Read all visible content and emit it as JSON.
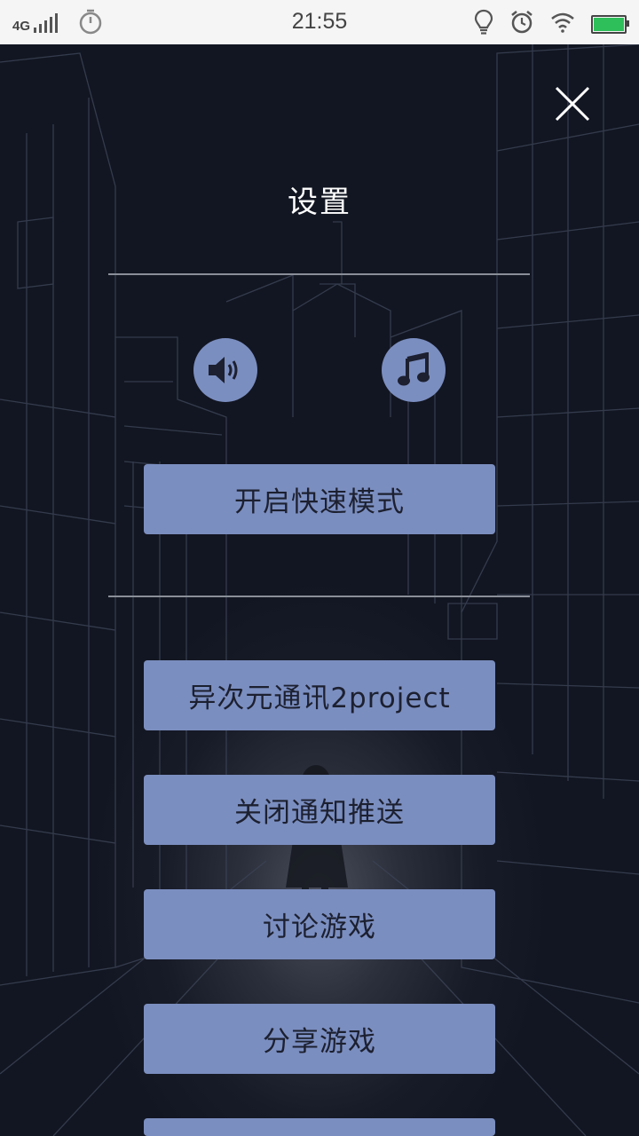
{
  "status_bar": {
    "network": "4G",
    "time": "21:55",
    "icons": [
      "signal-icon",
      "timer-icon",
      "bulb-icon",
      "alarm-icon",
      "wifi-icon",
      "battery-charging-icon"
    ]
  },
  "settings": {
    "title": "设置",
    "close_icon": "close-icon",
    "sound_icon": "speaker-icon",
    "music_icon": "music-note-icon",
    "fast_mode_label": "开启快速模式",
    "menu": [
      {
        "label": "异次元通讯2project"
      },
      {
        "label": "关闭通知推送"
      },
      {
        "label": "讨论游戏"
      },
      {
        "label": "分享游戏"
      }
    ]
  },
  "colors": {
    "button_bg": "#7b8ec0",
    "button_text": "#1c2030",
    "background": "#121622",
    "title": "#ffffff"
  }
}
